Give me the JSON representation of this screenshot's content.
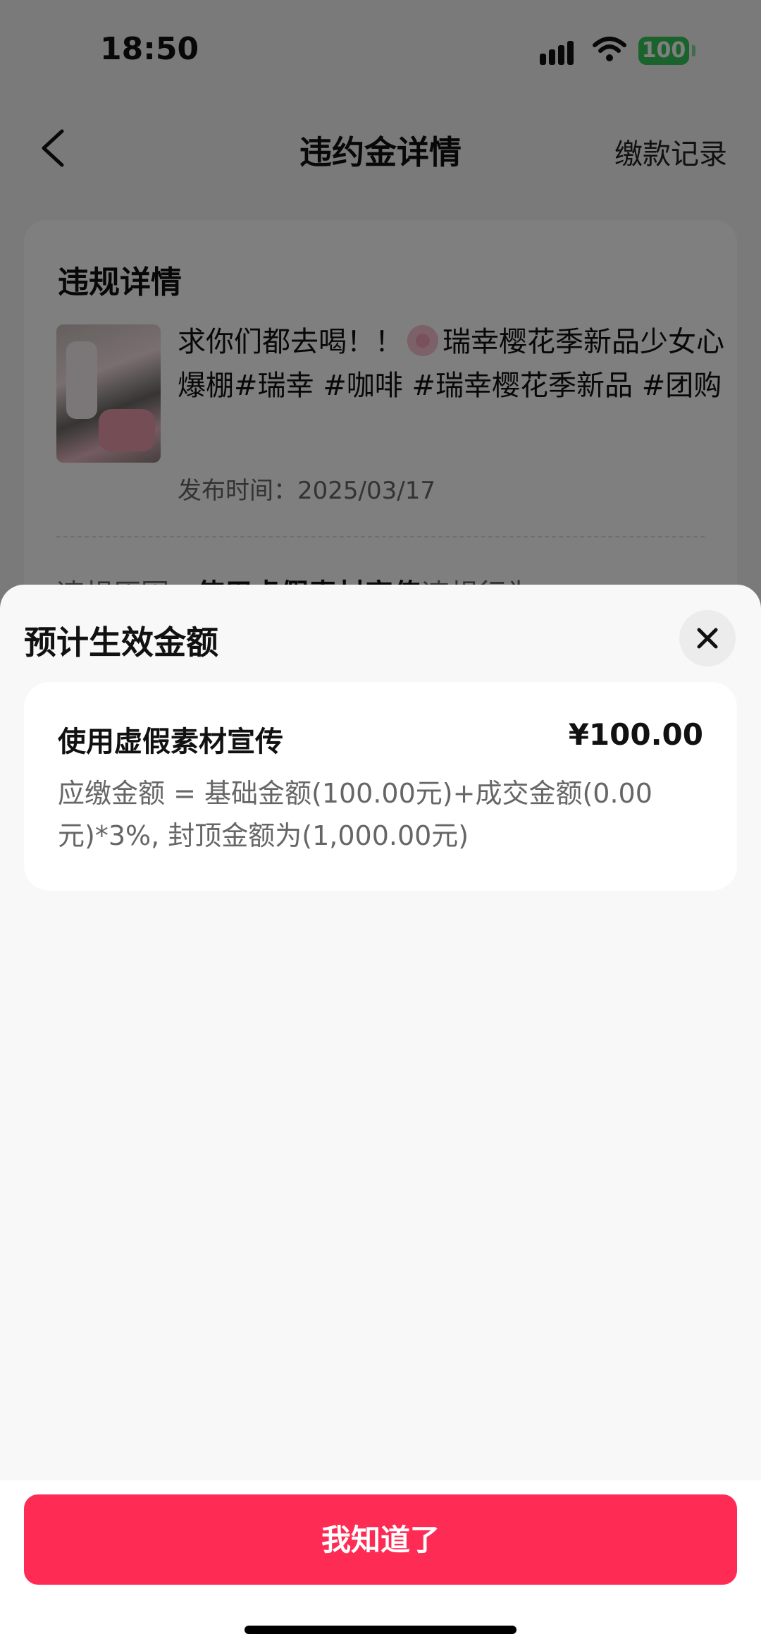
{
  "status_bar": {
    "time": "18:50",
    "battery": "100"
  },
  "nav": {
    "title": "违约金详情",
    "right_action": "缴款记录",
    "back_icon": "chevron-left-icon"
  },
  "card": {
    "title": "违规详情",
    "post_text_before_icon": "求你们都去喝！！",
    "post_text_after_icon": "瑞幸樱花季新品少女心爆棚#瑞幸 #咖啡 #瑞幸樱花季新品 #团购",
    "post_date": "发布时间：2025/03/17",
    "reason_label": "违规原因",
    "reason_value": "使用虚假素材宣传",
    "reason_suffix": "违规行为"
  },
  "sheet": {
    "title": "预计生效金额",
    "close_icon": "close-icon",
    "fee": {
      "name": "使用虚假素材宣传",
      "amount": "¥100.00",
      "formula": "应缴金额 = 基础金额(100.00元)+成交金额(0.00元)*3%, 封顶金额为(1,000.00元)"
    },
    "confirm_label": "我知道了"
  },
  "colors": {
    "accent": "#fe2c55",
    "battery": "#34c759",
    "sheet_bg": "#f8f8f8"
  }
}
